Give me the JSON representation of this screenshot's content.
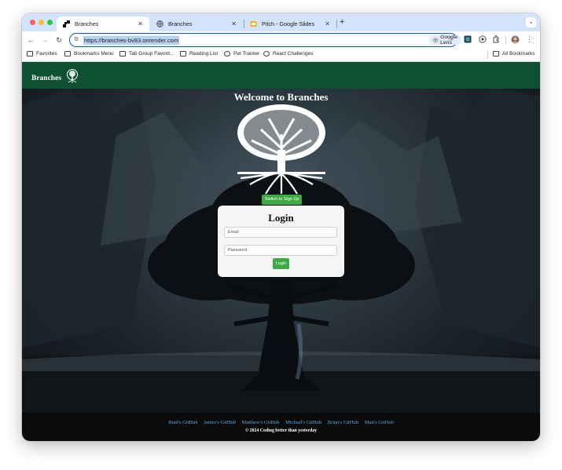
{
  "browser": {
    "tabs": [
      {
        "title": "Branches",
        "active": true
      },
      {
        "title": "Branches",
        "active": false
      },
      {
        "title": "Pitch - Google Slides",
        "active": false
      }
    ],
    "url": "https://branches-bv83.onrender.com",
    "lens_label": "Google Lens",
    "bookmarks": [
      {
        "label": "Favorites",
        "icon": "folder-icon"
      },
      {
        "label": "Bookmarks Menu",
        "icon": "folder-icon"
      },
      {
        "label": "Tab Group Favorit...",
        "icon": "folder-icon"
      },
      {
        "label": "Reading List",
        "icon": "folder-icon"
      },
      {
        "label": "Pet Tracker",
        "icon": "globe-icon"
      },
      {
        "label": "React Challenges",
        "icon": "globe-icon"
      }
    ],
    "all_bookmarks": "All Bookmarks"
  },
  "site": {
    "brand": "Branches",
    "welcome": "Welcome to Branches",
    "switch_button": "Switch to Sign Up",
    "login": {
      "title": "Login",
      "email_placeholder": "Email",
      "password_placeholder": "Password",
      "button": "Login"
    },
    "footer": {
      "links": [
        "Brad's GitHub",
        "James's GitHub",
        "Matthew's GitHub",
        "Michael's GitHub",
        "Brian's GitHub",
        "Matt's GitHub"
      ],
      "copyright": "© 2024 Coding better than yesterday"
    }
  },
  "colors": {
    "navbar": "#0e5032",
    "button": "#3eaa45",
    "link": "#5aa9e6",
    "tabstrip": "#d3e3fd"
  }
}
